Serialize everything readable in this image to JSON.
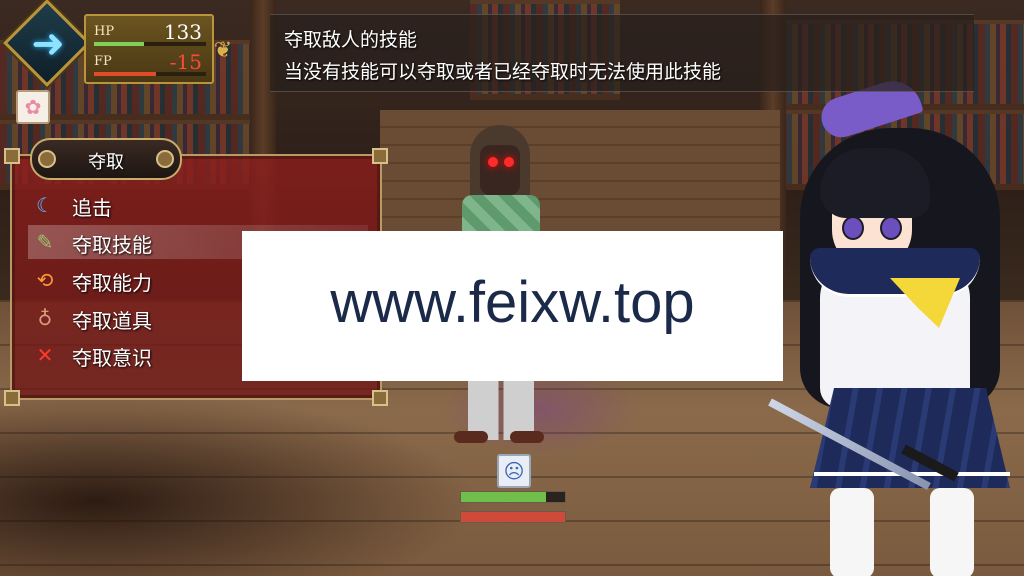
{
  "hud": {
    "hp_label": "HP",
    "hp_value": "133",
    "hp_fraction": 0.45,
    "fp_label": "FP",
    "fp_value": "-15",
    "fp_fraction": 0.55,
    "colors": {
      "hp_bar": "#7fd15a",
      "fp_bar": "#e24a2a",
      "panel": "#6b5420"
    }
  },
  "help": {
    "line1": "夺取敌人的技能",
    "line2": "当没有技能可以夺取或者已经夺取时无法使用此技能"
  },
  "menu": {
    "title": "夺取",
    "selected_index": 1,
    "items": [
      {
        "label": "追击",
        "icon": "crescent-slash-icon"
      },
      {
        "label": "夺取技能",
        "icon": "scroll-icon"
      },
      {
        "label": "夺取能力",
        "icon": "swap-arrows-icon"
      },
      {
        "label": "夺取道具",
        "icon": "pouch-icon"
      },
      {
        "label": "夺取意识",
        "icon": "crossed-swords-icon"
      }
    ]
  },
  "watermark": {
    "text": "www.feixw.top"
  },
  "enemy": {
    "hp_fraction": 0.82,
    "mp_fraction": 1.0,
    "colors": {
      "hp_bar": "#6fbf4a",
      "mp_bar": "#d04a3a"
    },
    "state_icon": "sad-face-icon"
  },
  "colors": {
    "menu_bg": "#8c1e1c",
    "frame_gold": "#b99a66"
  }
}
